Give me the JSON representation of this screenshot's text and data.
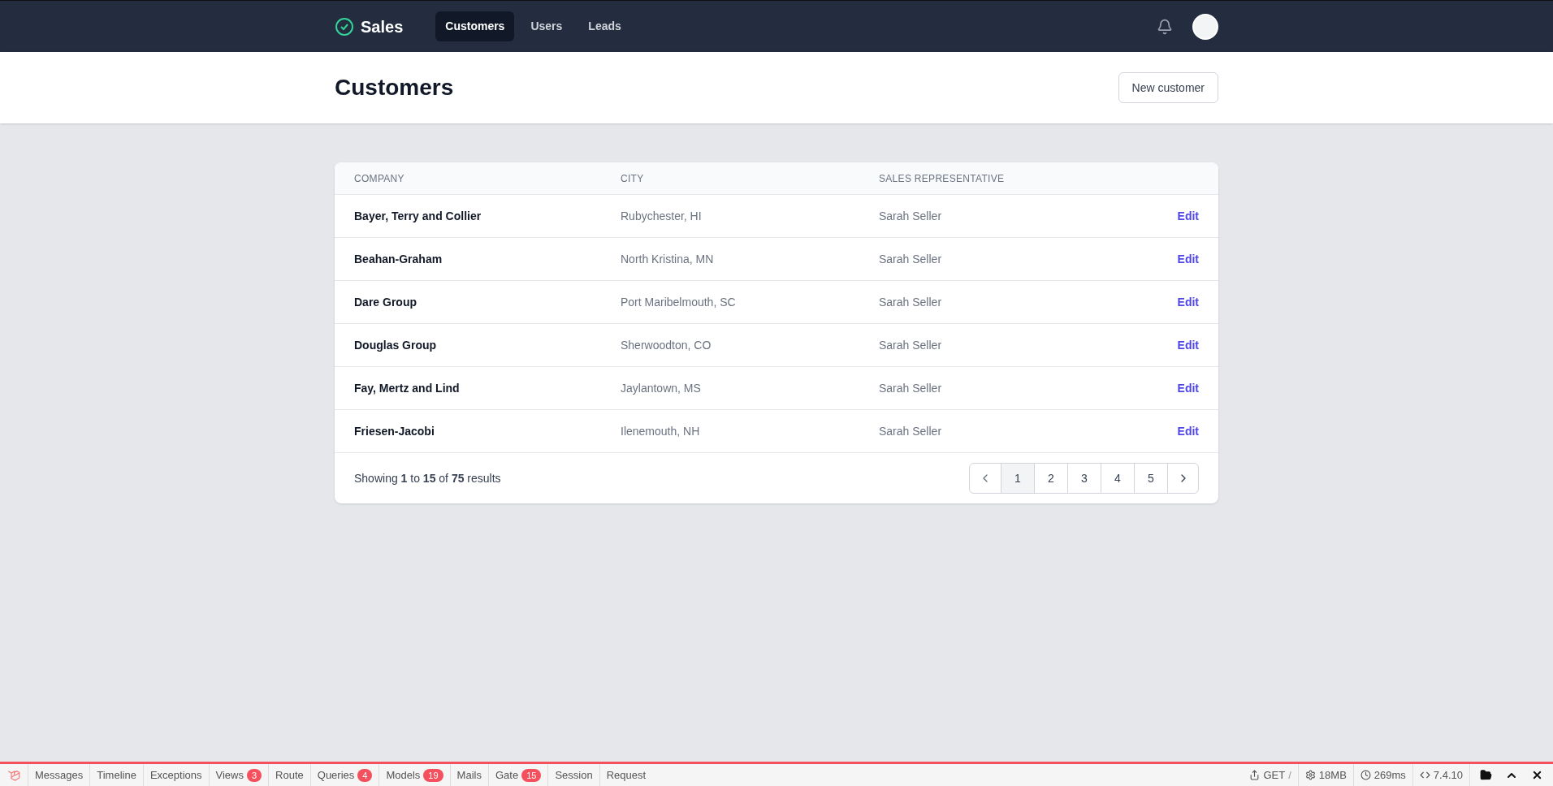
{
  "app": {
    "name": "Sales"
  },
  "nav": [
    {
      "label": "Customers",
      "selected": true
    },
    {
      "label": "Users",
      "selected": false
    },
    {
      "label": "Leads",
      "selected": false
    }
  ],
  "page": {
    "title": "Customers",
    "action": "New customer"
  },
  "table": {
    "columns": [
      "COMPANY",
      "CITY",
      "SALES REPRESENTATIVE"
    ],
    "rows": [
      {
        "company": "Bayer, Terry and Collier",
        "city": "Rubychester, HI",
        "rep": "Sarah Seller",
        "action": "Edit"
      },
      {
        "company": "Beahan-Graham",
        "city": "North Kristina, MN",
        "rep": "Sarah Seller",
        "action": "Edit"
      },
      {
        "company": "Dare Group",
        "city": "Port Maribelmouth, SC",
        "rep": "Sarah Seller",
        "action": "Edit"
      },
      {
        "company": "Douglas Group",
        "city": "Sherwoodton, CO",
        "rep": "Sarah Seller",
        "action": "Edit"
      },
      {
        "company": "Fay, Mertz and Lind",
        "city": "Jaylantown, MS",
        "rep": "Sarah Seller",
        "action": "Edit"
      },
      {
        "company": "Friesen-Jacobi",
        "city": "Ilenemouth, NH",
        "rep": "Sarah Seller",
        "action": "Edit"
      }
    ]
  },
  "pagination": {
    "summary": "Showing **1** to **15** of **75** results",
    "pages": [
      {
        "label": "1",
        "selected": true
      },
      {
        "label": "2",
        "selected": false
      },
      {
        "label": "3",
        "selected": false
      },
      {
        "label": "4",
        "selected": false
      },
      {
        "label": "5",
        "selected": false
      }
    ]
  },
  "debugbar": {
    "tabs": [
      {
        "label": "Messages"
      },
      {
        "label": "Timeline"
      },
      {
        "label": "Exceptions"
      },
      {
        "label": "Views",
        "badge": "3"
      },
      {
        "label": "Route"
      },
      {
        "label": "Queries",
        "badge": "4"
      },
      {
        "label": "Models",
        "badge": "19"
      },
      {
        "label": "Mails"
      },
      {
        "label": "Gate",
        "badge": "15"
      },
      {
        "label": "Session"
      },
      {
        "label": "Request"
      }
    ],
    "method": "GET",
    "path": "/",
    "memory": "18MB",
    "time": "269ms",
    "version": "7.4.10"
  }
}
